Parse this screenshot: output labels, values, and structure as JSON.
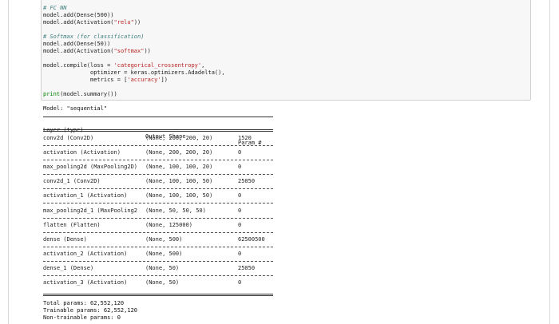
{
  "code": {
    "lines": [
      {
        "kind": "comment",
        "text": "# FC NN"
      },
      {
        "kind": "mixed",
        "parts": [
          {
            "t": "model.add(Dense(500))",
            "c": ""
          }
        ]
      },
      {
        "kind": "mixed",
        "parts": [
          {
            "t": "model.add(Activation(",
            "c": ""
          },
          {
            "t": "\"relu\"",
            "c": "str"
          },
          {
            "t": "))",
            "c": ""
          }
        ]
      },
      {
        "kind": "blank",
        "text": ""
      },
      {
        "kind": "comment",
        "text": "# Softmax (for classification)"
      },
      {
        "kind": "mixed",
        "parts": [
          {
            "t": "model.add(Dense(50))",
            "c": ""
          }
        ]
      },
      {
        "kind": "mixed",
        "parts": [
          {
            "t": "model.add(Activation(",
            "c": ""
          },
          {
            "t": "\"softmax\"",
            "c": "str"
          },
          {
            "t": "))",
            "c": ""
          }
        ]
      },
      {
        "kind": "blank",
        "text": ""
      },
      {
        "kind": "mixed",
        "parts": [
          {
            "t": "model.compile(loss = ",
            "c": ""
          },
          {
            "t": "'categorical_crossentropy'",
            "c": "str"
          },
          {
            "t": ",",
            "c": ""
          }
        ]
      },
      {
        "kind": "plain",
        "text": "              optimizer = keras.optimizers.Adadelta(),"
      },
      {
        "kind": "mixed",
        "parts": [
          {
            "t": "              metrics = [",
            "c": ""
          },
          {
            "t": "'accuracy'",
            "c": "str"
          },
          {
            "t": "])",
            "c": ""
          }
        ]
      },
      {
        "kind": "blank",
        "text": ""
      },
      {
        "kind": "mixed",
        "parts": [
          {
            "t": "print",
            "c": "fn"
          },
          {
            "t": "(model.summary())",
            "c": ""
          }
        ]
      }
    ]
  },
  "output": {
    "model_title": "Model: \"sequential\"",
    "headers": {
      "layer": "Layer (type)",
      "shape": "Output Shape",
      "params": "Param #"
    },
    "rows": [
      {
        "layer": "conv2d (Conv2D)",
        "shape": "(None, 200, 200, 20)",
        "params": "1520"
      },
      {
        "layer": "activation (Activation)",
        "shape": "(None, 200, 200, 20)",
        "params": "0"
      },
      {
        "layer": "max_pooling2d (MaxPooling2D)",
        "shape": "(None, 100, 100, 20)",
        "params": "0"
      },
      {
        "layer": "conv2d_1 (Conv2D)",
        "shape": "(None, 100, 100, 50)",
        "params": "25050"
      },
      {
        "layer": "activation_1 (Activation)",
        "shape": "(None, 100, 100, 50)",
        "params": "0"
      },
      {
        "layer": "max_pooling2d_1 (MaxPooling2",
        "shape": "(None, 50, 50, 50)",
        "params": "0"
      },
      {
        "layer": "flatten (Flatten)",
        "shape": "(None, 125000)",
        "params": "0"
      },
      {
        "layer": "dense (Dense)",
        "shape": "(None, 500)",
        "params": "62500500"
      },
      {
        "layer": "activation_2 (Activation)",
        "shape": "(None, 500)",
        "params": "0"
      },
      {
        "layer": "dense_1 (Dense)",
        "shape": "(None, 50)",
        "params": "25050"
      },
      {
        "layer": "activation_3 (Activation)",
        "shape": "(None, 50)",
        "params": "0"
      }
    ],
    "totals": [
      "Total params: 62,552,120",
      "Trainable params: 62,552,120",
      "Non-trainable params: 0"
    ]
  }
}
